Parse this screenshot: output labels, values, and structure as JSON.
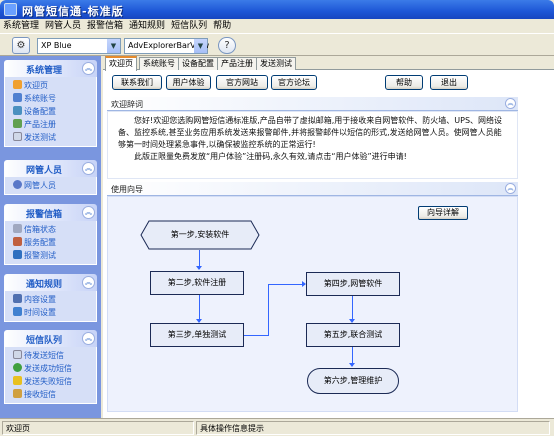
{
  "window": {
    "title": "网管短信通-标准版"
  },
  "menu": [
    "系统管理",
    "网管人员",
    "报警信箱",
    "通知规则",
    "短信队列",
    "帮助"
  ],
  "toolbar": {
    "theme_value": "XP Blue",
    "style_value": "AdvExplorerBarView"
  },
  "sidebar": {
    "panels": [
      {
        "title": "系统管理",
        "items": [
          "欢迎页",
          "系统账号",
          "设备配置",
          "产品注册",
          "发送测试"
        ]
      },
      {
        "title": "网管人员",
        "items": [
          "网管人员"
        ]
      },
      {
        "title": "报警信箱",
        "items": [
          "信箱状态",
          "服务配置",
          "报警测试"
        ]
      },
      {
        "title": "通知规则",
        "items": [
          "内容设置",
          "时间设置"
        ]
      },
      {
        "title": "短信队列",
        "items": [
          "待发送短信",
          "发送成功短信",
          "发送失败短信",
          "接收短信"
        ]
      }
    ]
  },
  "tabs": [
    "欢迎页",
    "系统账号",
    "设备配置",
    "产品注册",
    "发送测试"
  ],
  "buttons": {
    "contact": "联系我们",
    "trial": "用户体验",
    "website": "官方网站",
    "forum": "官方论坛",
    "help": "帮助",
    "exit": "退出"
  },
  "welcome": {
    "title": "欢迎辞词",
    "p1": "您好!欢迎您选购网管短信通标准版,产品自带了虚拟邮箱,用于接收来自网管软件、防火墙、UPS、网络设备、监控系统,甚至业务应用系统发送来报警邮件,并将报警邮件以短信的形式,发送给网管人员。使网管人员能够第一时间处理紧急事件,以确保被监控系统的正常运行!",
    "p2": "此版正限量免费发放“用户体验”注册码,永久有效,请点击“用户体验”进行申请!"
  },
  "guide": {
    "title": "使用向导",
    "detail_button": "向导详解",
    "steps": [
      "第一步,安装软件",
      "第二步,软件注册",
      "第三步,单独测试",
      "第四步,网管软件",
      "第五步,联合测试",
      "第六步,管理维护"
    ]
  },
  "statusbar": {
    "left": "欢迎页",
    "right": "具体操作信息提示"
  },
  "colors": {
    "titlebar": "#1d56d6",
    "sidebar": "#7a96df",
    "panel_title": "#215dc6",
    "flow_line": "#3366ff"
  }
}
